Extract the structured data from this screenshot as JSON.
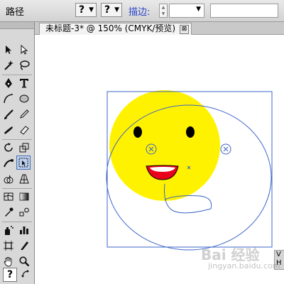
{
  "control_bar": {
    "path_label": "路径",
    "fill_button": "?",
    "stroke_button": "?",
    "stroke_label": "描边:",
    "stroke_value": ""
  },
  "document": {
    "tab_title": "未标题-3* @ 150% (CMYK/预览)",
    "close_glyph": "⊠"
  },
  "tools": {
    "help_glyph": "?"
  },
  "panel_stub": "V\nH",
  "watermark": {
    "text": "Bai 经验",
    "sub": "jingyan.baidu.com"
  },
  "colors": {
    "face_fill": "#fff200",
    "eyes": "#000000",
    "mouth_fill": "#e8001c",
    "selection": "#3c64c8",
    "panel_bg": "#d8d8d8",
    "canvas_bg": "#ffffff"
  }
}
